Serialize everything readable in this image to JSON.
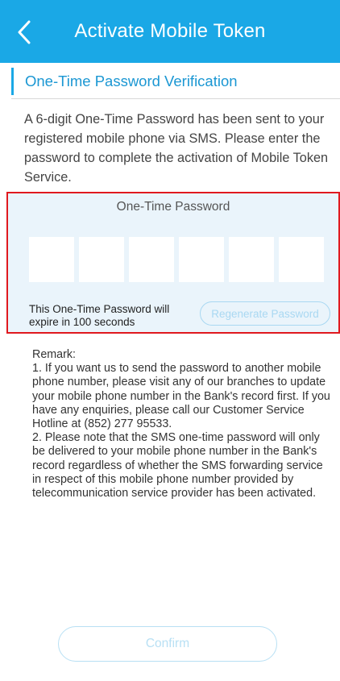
{
  "header": {
    "title": "Activate Mobile Token",
    "back_icon": "chevron-left-icon",
    "background_color": "#1aa8e6"
  },
  "section": {
    "title": "One-Time Password Verification"
  },
  "intro": {
    "text": "A 6-digit One-Time Password has been sent to your registered mobile phone via SMS. Please enter the password to complete the activation of Mobile Token Service."
  },
  "otp": {
    "label": "One-Time Password",
    "digits": [
      "",
      "",
      "",
      "",
      "",
      ""
    ],
    "expiry_text": "This One-Time Password will expire in  100 seconds",
    "regenerate_label": "Regenerate Password",
    "highlight_color": "#e0191f"
  },
  "remark": {
    "heading": "Remark:",
    "item1": "1. If you want us to send the password to another mobile phone number, please visit any of our branches to update your mobile phone number in the Bank's record first. If you have any enquiries, please call our Customer Service Hotline at (852) 277 95533.",
    "item2": "2. Please note that the SMS one-time password will only be delivered to your mobile phone number in the Bank's record regardless of whether the SMS forwarding service in respect of this mobile phone number provided by telecommunication service provider has been activated."
  },
  "actions": {
    "confirm_label": "Confirm"
  }
}
